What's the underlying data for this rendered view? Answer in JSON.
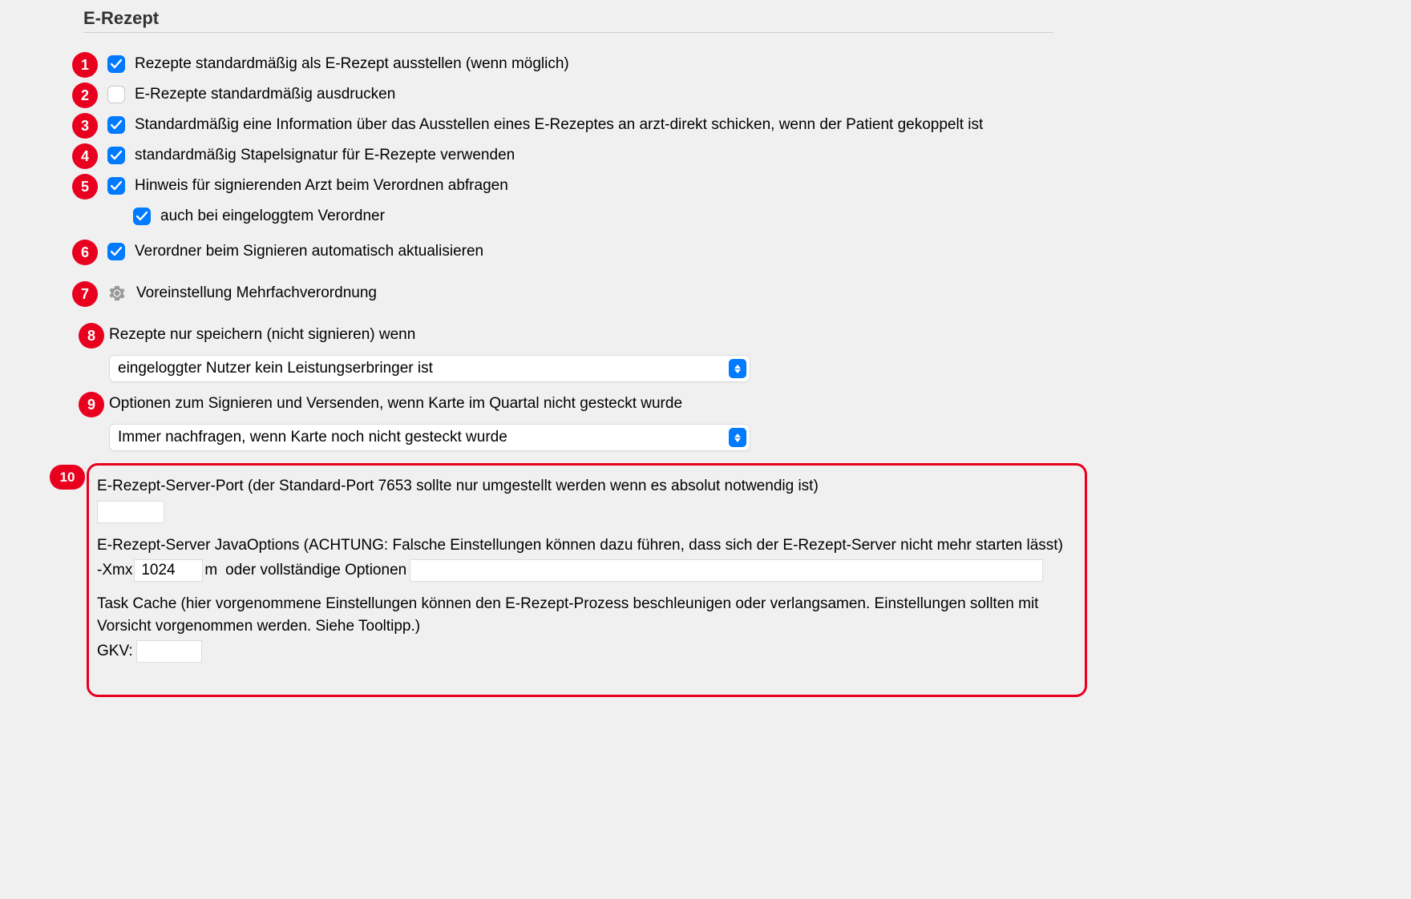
{
  "section": {
    "title": "E-Rezept"
  },
  "badges": {
    "n1": "1",
    "n2": "2",
    "n3": "3",
    "n4": "4",
    "n5": "5",
    "n6": "6",
    "n7": "7",
    "n8": "8",
    "n9": "9",
    "n10": "10"
  },
  "checkboxes": {
    "opt1": {
      "checked": true,
      "label": "Rezepte standardmäßig als E-Rezept ausstellen (wenn möglich)"
    },
    "opt2": {
      "checked": false,
      "label": "E-Rezepte standardmäßig ausdrucken"
    },
    "opt3": {
      "checked": true,
      "label": "Standardmäßig eine Information über das Ausstellen eines E-Rezeptes an arzt-direkt schicken, wenn der Patient gekoppelt ist"
    },
    "opt4": {
      "checked": true,
      "label": "standardmäßig Stapelsignatur für E-Rezepte verwenden"
    },
    "opt5": {
      "checked": true,
      "label": "Hinweis für signierenden Arzt beim Verordnen abfragen"
    },
    "opt5a": {
      "checked": true,
      "label": "auch bei eingeloggtem Verordner"
    },
    "opt6": {
      "checked": true,
      "label": "Verordner beim Signieren automatisch aktualisieren"
    }
  },
  "item7": {
    "label": "Voreinstellung Mehrfachverordnung"
  },
  "item8": {
    "label": "Rezepte nur speichern (nicht signieren) wenn",
    "selected": "eingeloggter Nutzer kein Leistungserbringer ist"
  },
  "item9": {
    "label": "Optionen zum Signieren und Versenden, wenn Karte im Quartal nicht gesteckt wurde",
    "selected": "Immer nachfragen, wenn Karte noch nicht gesteckt wurde"
  },
  "server": {
    "port_label": "E-Rezept-Server-Port (der Standard-Port 7653 sollte nur umgestellt werden wenn es absolut notwendig ist)",
    "port_value": "",
    "java_label": "E-Rezept-Server JavaOptions (ACHTUNG: Falsche Einstellungen können dazu führen, dass sich der E-Rezept-Server nicht mehr starten lässt)",
    "xmx_prefix": "-Xmx",
    "xmx_value": "1024",
    "xmx_suffix_m": "m",
    "xmx_or": "oder vollständige Optionen",
    "opts_value": "",
    "cache_label": "Task Cache (hier vorgenommene Einstellungen können den E-Rezept-Prozess beschleunigen oder verlangsamen. Einstellungen sollten mit Vorsicht vorgenommen werden. Siehe Tooltipp.)",
    "gkv_label": "GKV:",
    "gkv_value": ""
  }
}
